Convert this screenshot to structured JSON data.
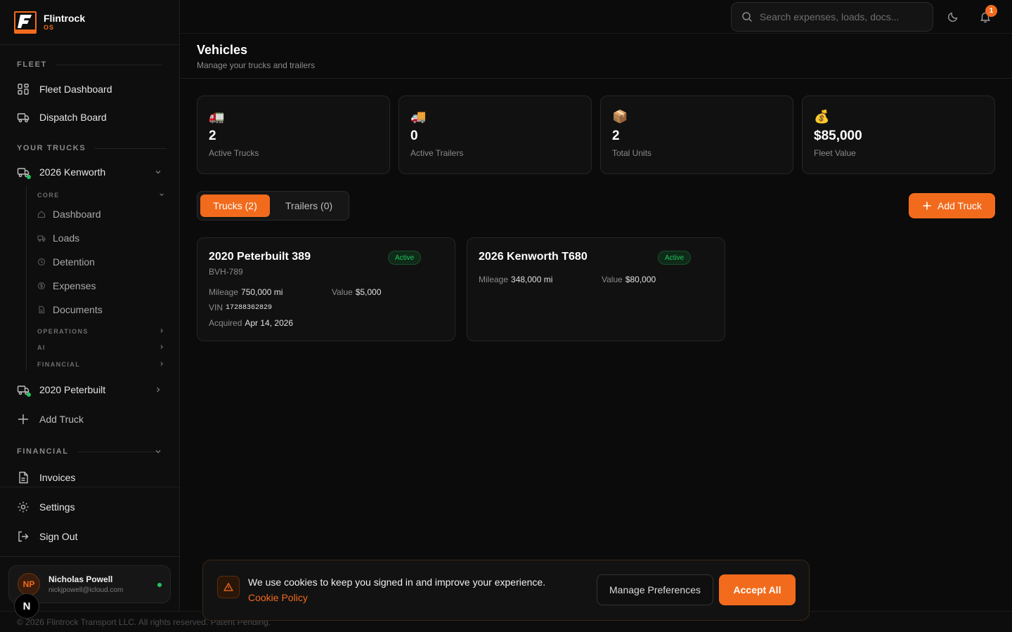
{
  "brand": {
    "name": "Flintrock",
    "sub": "OS",
    "logo_letter": "F"
  },
  "sidebar": {
    "fleet_label": "FLEET",
    "fleet_items": [
      {
        "label": "Fleet Dashboard",
        "icon": "grid-icon"
      },
      {
        "label": "Dispatch Board",
        "icon": "truck-icon"
      }
    ],
    "your_trucks_label": "YOUR TRUCKS",
    "truck1": {
      "label": "2026 Kenworth",
      "core_label": "CORE",
      "core_items": [
        "Dashboard",
        "Loads",
        "Detention",
        "Expenses",
        "Documents"
      ],
      "operations_label": "OPERATIONS",
      "ai_label": "AI",
      "financial_label": "FINANCIAL"
    },
    "truck2": {
      "label": "2020 Peterbuilt"
    },
    "add_truck": "Add Truck",
    "financial_label": "FINANCIAL",
    "invoices": "Invoices",
    "settings": "Settings",
    "sign_out": "Sign Out"
  },
  "user": {
    "initials": "NP",
    "name": "Nicholas Powell",
    "email": "nickjpowell@icloud.com"
  },
  "n_badge": "N",
  "topbar": {
    "search_placeholder": "Search expenses, loads, docs...",
    "notification_count": "1"
  },
  "page": {
    "title": "Vehicles",
    "subtitle": "Manage your trucks and trailers"
  },
  "stats": [
    {
      "emoji": "🚛",
      "value": "2",
      "label": "Active Trucks"
    },
    {
      "emoji": "🚚",
      "value": "0",
      "label": "Active Trailers"
    },
    {
      "emoji": "📦",
      "value": "2",
      "label": "Total Units"
    },
    {
      "emoji": "💰",
      "value": "$85,000",
      "label": "Fleet Value"
    }
  ],
  "tabs": {
    "trucks": "Trucks (2)",
    "trailers": "Trailers (0)"
  },
  "add_truck_button": "Add Truck",
  "vehicles": [
    {
      "title": "2020 Peterbuilt 389",
      "status": "Active",
      "plate": "BVH-789",
      "mileage_label": "Mileage",
      "mileage": "750,000 mi",
      "value_label": "Value",
      "value": "$5,000",
      "vin_label": "VIN",
      "vin": "17288362829",
      "acquired_label": "Acquired",
      "acquired": "Apr 14, 2026"
    },
    {
      "title": "2026 Kenworth T680",
      "status": "Active",
      "mileage_label": "Mileage",
      "mileage": "348,000 mi",
      "value_label": "Value",
      "value": "$80,000"
    }
  ],
  "cookie": {
    "message": "We use cookies to keep you signed in and improve your experience.",
    "link": "Cookie Policy",
    "manage": "Manage Preferences",
    "accept": "Accept All"
  },
  "footer": "© 2026 Flintrock Transport LLC. All rights reserved. Patent Pending.",
  "colors": {
    "accent": "#f26b1d",
    "success": "#22c55e",
    "background": "#0b0b0b"
  }
}
